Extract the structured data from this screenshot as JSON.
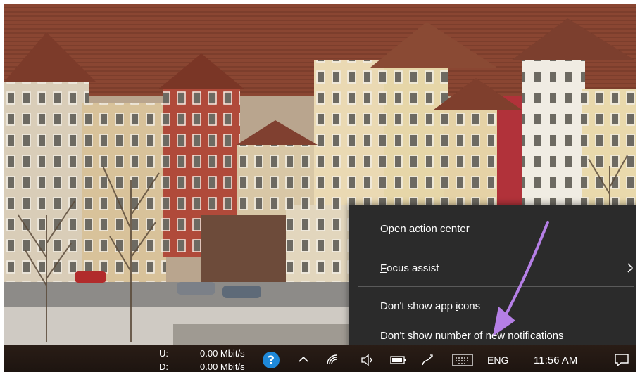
{
  "context_menu": {
    "items": [
      {
        "prefix": "",
        "accel": "O",
        "rest": "pen action center",
        "has_submenu": false
      },
      {
        "prefix": "",
        "accel": "F",
        "rest": "ocus assist",
        "has_submenu": true
      },
      {
        "prefix": "Don't show app ",
        "accel": "i",
        "rest": "cons",
        "has_submenu": false
      },
      {
        "prefix": "Don't show ",
        "accel": "n",
        "rest": "umber of new notifications",
        "has_submenu": false
      }
    ]
  },
  "taskbar": {
    "net_upload_label": "U:",
    "net_download_label": "D:",
    "net_upload_value": "0.00 Mbit/s",
    "net_download_value": "0.00 Mbit/s",
    "language": "ENG",
    "clock": "11:56 AM",
    "icons": [
      "help-icon",
      "chevron-up-icon",
      "wifi-icon",
      "volume-icon",
      "battery-icon",
      "pen-icon",
      "keyboard-icon",
      "notification-icon"
    ]
  },
  "colors": {
    "menu_bg": "#2b2b2b",
    "menu_text": "#ffffff",
    "annotation_arrow": "#b57fe6",
    "taskbar_bg": "#21160f"
  }
}
